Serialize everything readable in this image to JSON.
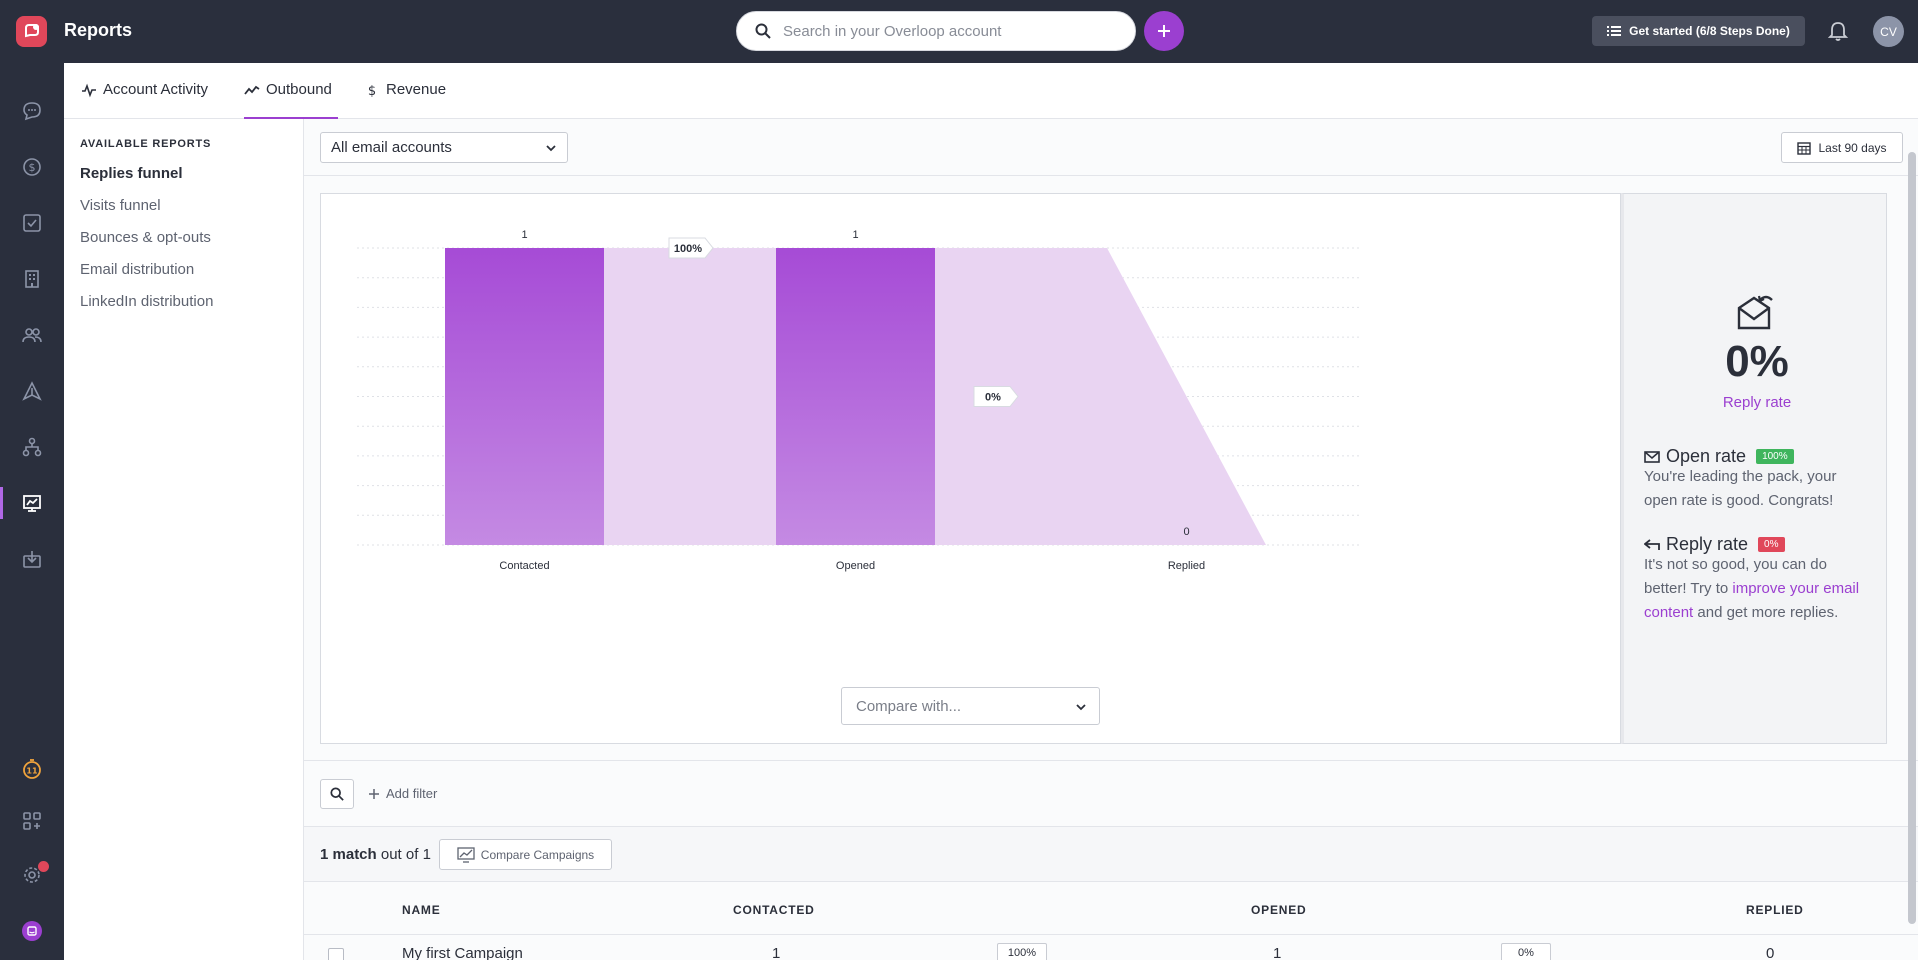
{
  "app": {
    "title": "Reports"
  },
  "header": {
    "search_placeholder": "Search in your Overloop account",
    "get_started": "Get started (6/8 Steps Done)",
    "avatar_initials": "CV",
    "rail_badge": "11"
  },
  "tabs": [
    {
      "label": "Account Activity",
      "icon": "activity-icon"
    },
    {
      "label": "Outbound",
      "icon": "trend-icon",
      "active": true
    },
    {
      "label": "Revenue",
      "icon": "dollar-icon"
    }
  ],
  "reports_nav": {
    "heading": "AVAILABLE REPORTS",
    "items": [
      "Replies funnel",
      "Visits funnel",
      "Bounces & opt-outs",
      "Email distribution",
      "LinkedIn distribution"
    ],
    "active_index": 0
  },
  "filters": {
    "account_select": "All email accounts",
    "date_range": "Last 90 days",
    "compare_with": "Compare with..."
  },
  "chart_data": {
    "type": "bar",
    "categories": [
      "Contacted",
      "Opened",
      "Replied"
    ],
    "values": [
      1,
      1,
      0
    ],
    "conversion_labels": [
      "100%",
      "0%"
    ],
    "ylim": [
      0,
      1
    ],
    "grid": true,
    "colors": {
      "bar": "#a64bd6",
      "funnel": "#e9d4f2"
    }
  },
  "summary": {
    "main_value": "0%",
    "main_label": "Reply rate",
    "open_rate": {
      "title": "Open rate",
      "badge": "100%",
      "badge_color": "#3fb55d",
      "text": "You're leading the pack, your open rate is good. Congrats!"
    },
    "reply_rate": {
      "title": "Reply rate",
      "badge": "0%",
      "badge_color": "#e0475a",
      "text_before": "It's not so good, you can do better! Try to",
      "link": "improve your email content",
      "text_after": "and get more replies."
    }
  },
  "table_tools": {
    "add_filter": "Add filter",
    "match_count": "1 match",
    "match_total": "out of 1",
    "compare_campaigns": "Compare Campaigns"
  },
  "table": {
    "headers": [
      "NAME",
      "CONTACTED",
      "OPENED",
      "REPLIED"
    ],
    "rows": [
      {
        "name": "My first Campaign",
        "contacted": "1",
        "open_pct": "100%",
        "opened": "1",
        "reply_pct": "0%",
        "replied": "0"
      }
    ]
  }
}
